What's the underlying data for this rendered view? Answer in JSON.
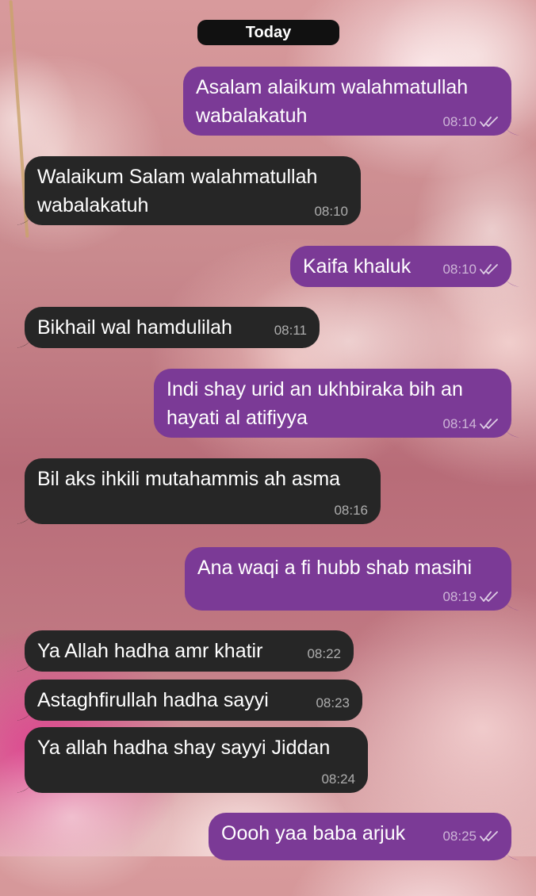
{
  "chat": {
    "date_label": "Today",
    "colors": {
      "outgoing": "#7b3a96",
      "incoming": "#262626",
      "date_pill": "#111111"
    },
    "read_indicator_icon": "double-check-icon",
    "messages": [
      {
        "dir": "out",
        "lines": [
          "Asalam alaikum walahmatullah",
          "wabalakatuh"
        ],
        "time": "08:10",
        "read": true
      },
      {
        "dir": "in",
        "lines": [
          "Walaikum Salam walahmatullah",
          "wabalakatuh"
        ],
        "time": "08:10"
      },
      {
        "dir": "out",
        "lines": [
          "Kaifa khaluk"
        ],
        "time": "08:10",
        "read": true
      },
      {
        "dir": "in",
        "lines": [
          "Bikhail wal hamdulilah"
        ],
        "time": "08:11"
      },
      {
        "dir": "out",
        "lines": [
          "Indi shay urid an ukhbiraka bih an",
          "hayati al atifiyya"
        ],
        "time": "08:14",
        "read": true
      },
      {
        "dir": "in",
        "lines": [
          "Bil aks ihkili mutahammis ah asma"
        ],
        "time": "08:16"
      },
      {
        "dir": "out",
        "lines": [
          "Ana waqi a fi hubb shab masihi"
        ],
        "time": "08:19",
        "read": true
      },
      {
        "dir": "in",
        "lines": [
          "Ya Allah hadha amr khatir"
        ],
        "time": "08:22"
      },
      {
        "dir": "in",
        "lines": [
          "Astaghfirullah hadha sayyi"
        ],
        "time": "08:23"
      },
      {
        "dir": "in",
        "lines": [
          "Ya allah hadha shay sayyi Jiddan"
        ],
        "time": "08:24"
      },
      {
        "dir": "out",
        "lines": [
          "Oooh yaa baba arjuk"
        ],
        "time": "08:25",
        "read": true
      }
    ]
  }
}
